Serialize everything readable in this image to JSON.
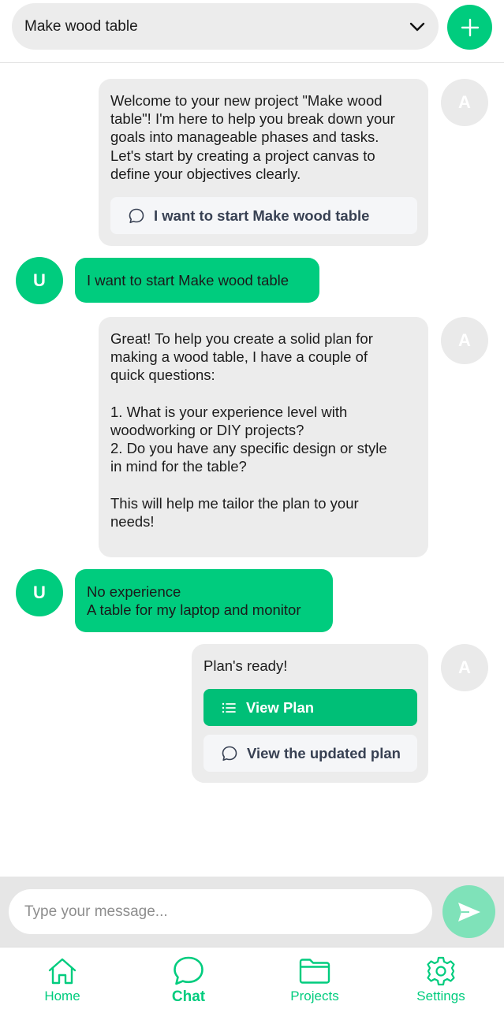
{
  "header": {
    "project_name": "Make wood table"
  },
  "messages": {
    "m1": {
      "avatar": "A",
      "text": "Welcome to your new project \"Make wood\ntable\"! I'm here to help you break down your\ngoals into manageable phases and tasks.\nLet's start by creating a project canvas to\ndefine your objectives clearly.",
      "suggestion": "I want to start Make wood table"
    },
    "m2": {
      "avatar": "U",
      "text": "I want to start Make wood table"
    },
    "m3": {
      "avatar": "A",
      "text": "Great! To help you create a solid plan for\nmaking a wood table, I have a couple of\nquick questions:\n\n1. What is your experience level with\nwoodworking or DIY projects?\n2. Do you have any specific design or style\nin mind for the table?\n\nThis will help me tailor the plan to your\nneeds!"
    },
    "m4": {
      "avatar": "U",
      "text": "No experience\nA table for my laptop and monitor"
    },
    "m5": {
      "avatar": "A",
      "text": "Plan's ready!",
      "primary": "View Plan",
      "suggestion": "View the updated plan"
    }
  },
  "composer": {
    "placeholder": "Type your message..."
  },
  "nav": {
    "home": "Home",
    "chat": "Chat",
    "projects": "Projects",
    "settings": "Settings",
    "active": "chat"
  },
  "colors": {
    "accent": "#00cc7e",
    "bubble_ai": "#ececec",
    "send_disabled": "#7fe2b9"
  }
}
